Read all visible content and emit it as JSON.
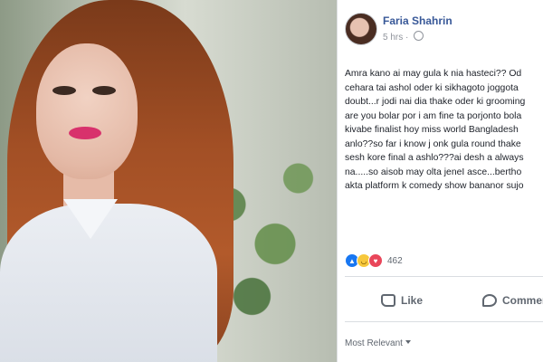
{
  "post": {
    "author": "Faria Shahrin",
    "time": "5 hrs",
    "privacy_icon": "globe-icon",
    "lines": [
      "Amra kano ai may gula k nia hasteci?? Od",
      "cehara tai ashol oder ki sikhagoto joggota",
      "doubt...r jodi nai dia thake oder ki grooming",
      "are you bolar por i am fine ta porjonto bola",
      "kivabe finalist hoy miss world Bangladesh",
      "anlo??so far i know j onk gula round thake",
      "sesh kore final a ashlo???ai desh a always",
      "na.....so aisob may olta jeneI asce...bertho",
      "akta platform k comedy show bananor sujo"
    ]
  },
  "reactions": {
    "icons": [
      "like-reaction-icon",
      "haha-reaction-icon",
      "love-reaction-icon"
    ],
    "count": "462"
  },
  "actions": {
    "like_label": "Like",
    "comment_label": "Comment"
  },
  "comments_filter": {
    "label": "Most Relevant"
  },
  "colors": {
    "author_link": "#385898",
    "like_blue": "#1877f2",
    "love_red": "#e9465a",
    "haha_yellow": "#f7c83c"
  }
}
